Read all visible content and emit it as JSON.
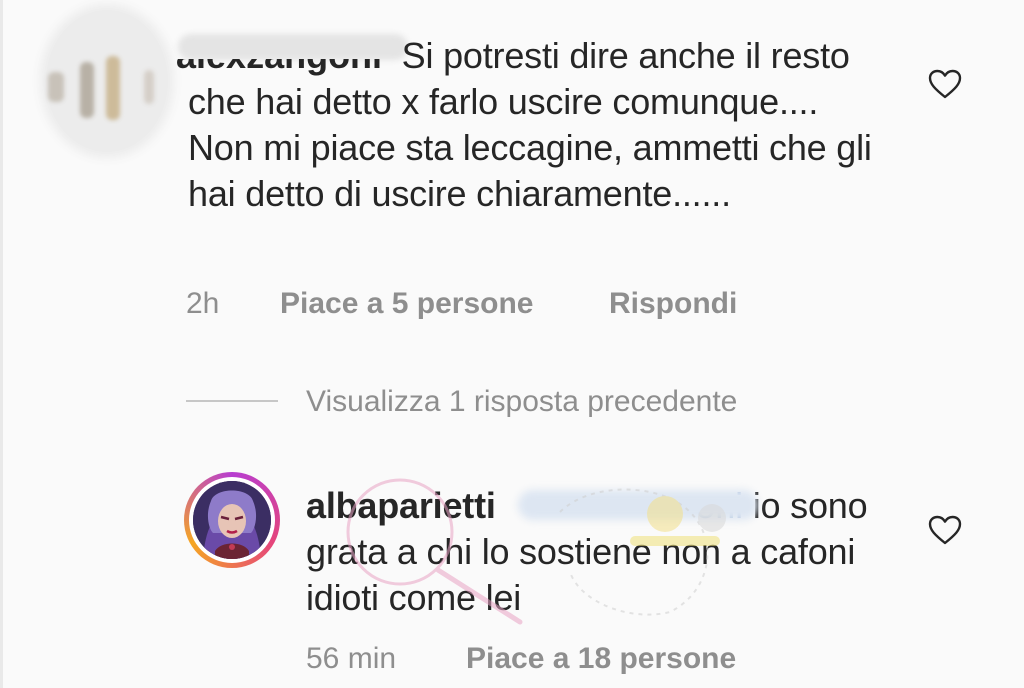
{
  "comment_1": {
    "username_partial": "alexzangoni",
    "text": "Si potresti dire anche il resto che hai detto x farlo uscire comunque.... Non mi piace sta leccagine, ammetti che gli hai detto di uscire chiaramente......",
    "time": "2h",
    "likes": "Piace a 5 persone",
    "reply_label": "Rispondi"
  },
  "replies_toggle": {
    "label": "Visualizza 1 risposta precedente"
  },
  "comment_2": {
    "username": "albaparietti",
    "mention_partial": "oni",
    "text": "io sono grata a chi lo sostiene non a cafoni idioti come lei",
    "time": "56 min",
    "likes": "Piace a 18 persone"
  },
  "colors": {
    "text": "#262626",
    "meta": "#8e8e8e",
    "divider": "#c7c7c7",
    "background": "#fafafa"
  },
  "icons": {
    "like": "heart-outline-icon"
  }
}
